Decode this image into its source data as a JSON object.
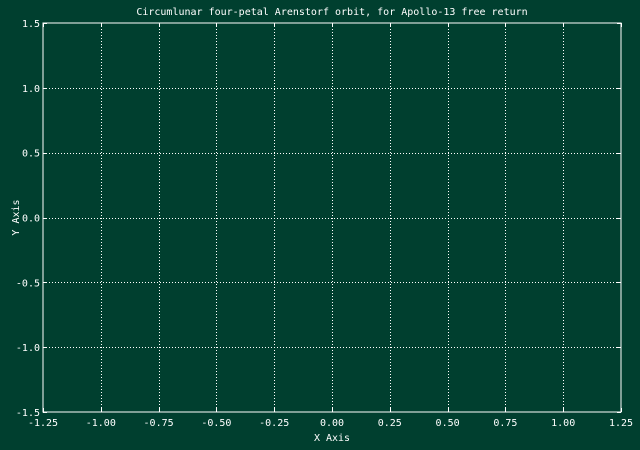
{
  "colors": {
    "background": "#003F2F",
    "foreground": "#FFFFFF",
    "grid": "#FFFFFF"
  },
  "chart_data": {
    "type": "line",
    "title": "Circumlunar four-petal Arenstorf orbit, for Apollo-13 free return",
    "xlabel": "X Axis",
    "ylabel": "Y Axis",
    "xlim": [
      -1.25,
      1.25
    ],
    "ylim": [
      -1.5,
      1.5
    ],
    "xticks": [
      -1.25,
      -1.0,
      -0.75,
      -0.5,
      -0.25,
      0.0,
      0.25,
      0.5,
      0.75,
      1.0,
      1.25
    ],
    "yticks": [
      -1.5,
      -1.0,
      -0.5,
      0.0,
      0.5,
      1.0,
      1.5
    ],
    "xtick_labels": [
      "-1.25",
      "-1.00",
      "-0.75",
      "-0.50",
      "-0.25",
      "0.00",
      "0.25",
      "0.50",
      "0.75",
      "1.00",
      "1.25"
    ],
    "ytick_labels": [
      "-1.5",
      "-1.0",
      "-0.5",
      "0.0",
      "0.5",
      "1.0",
      "1.5"
    ],
    "grid": true,
    "grid_style": "dotted",
    "series": []
  }
}
